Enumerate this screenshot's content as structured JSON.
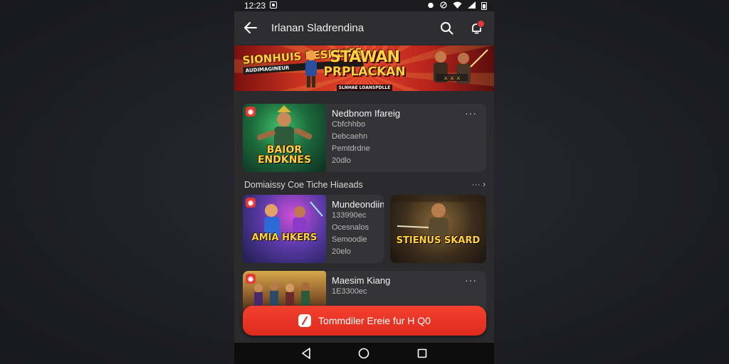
{
  "status_bar": {
    "time": "12:23",
    "icons": [
      "gallery-icon",
      "alarm-icon",
      "dnd-icon",
      "wifi-icon",
      "signal-icon",
      "battery-icon"
    ]
  },
  "app_bar": {
    "title": "Irlanan Sladrendina",
    "back_icon": "arrow-left-icon",
    "search_icon": "search-icon",
    "notification_icon": "bell-icon"
  },
  "banner": {
    "left_text": "SIONHUIS PESNLIES",
    "left_sub": "AUDIMAGINEUR",
    "center_line1": "STAWAN",
    "center_line2": "PRPLACKAN",
    "center_sub": "SLNHAE LOANSPDLLE"
  },
  "featured": {
    "thumb_text": "BAIOR ENDKNES",
    "title": "Nedbnom Ifareig",
    "lines": [
      "Cbfchhbo",
      "Debcaehn",
      "Pemtdrdne",
      "20dlo"
    ],
    "more_label": "···"
  },
  "section": {
    "title": "Domiaissy Coe Tiche Hiaeads",
    "more_label": "··· ›"
  },
  "row_card": {
    "thumb_text": "AMIA HKERS",
    "title": "Mundeondiin",
    "lines": [
      "133990ec",
      "Ocesnalos",
      "Semoodie",
      "20elo"
    ]
  },
  "side_card": {
    "thumb_text": "STIENUS SKARD"
  },
  "bottom_card": {
    "thumb_text": "",
    "title": "Maesim Kiang",
    "lines": [
      "1E3300ec"
    ],
    "more_label": "···"
  },
  "cta": {
    "label": "Tommdiler Ereie fur H Q0",
    "icon": "slash-icon"
  },
  "nav": {
    "back": "back-triangle-icon",
    "home": "home-circle-icon",
    "recents": "recents-square-icon"
  },
  "colors": {
    "accent": "#e53935",
    "cta": "#ef3b2c",
    "background": "#2b2b2e",
    "card": "#343437"
  }
}
